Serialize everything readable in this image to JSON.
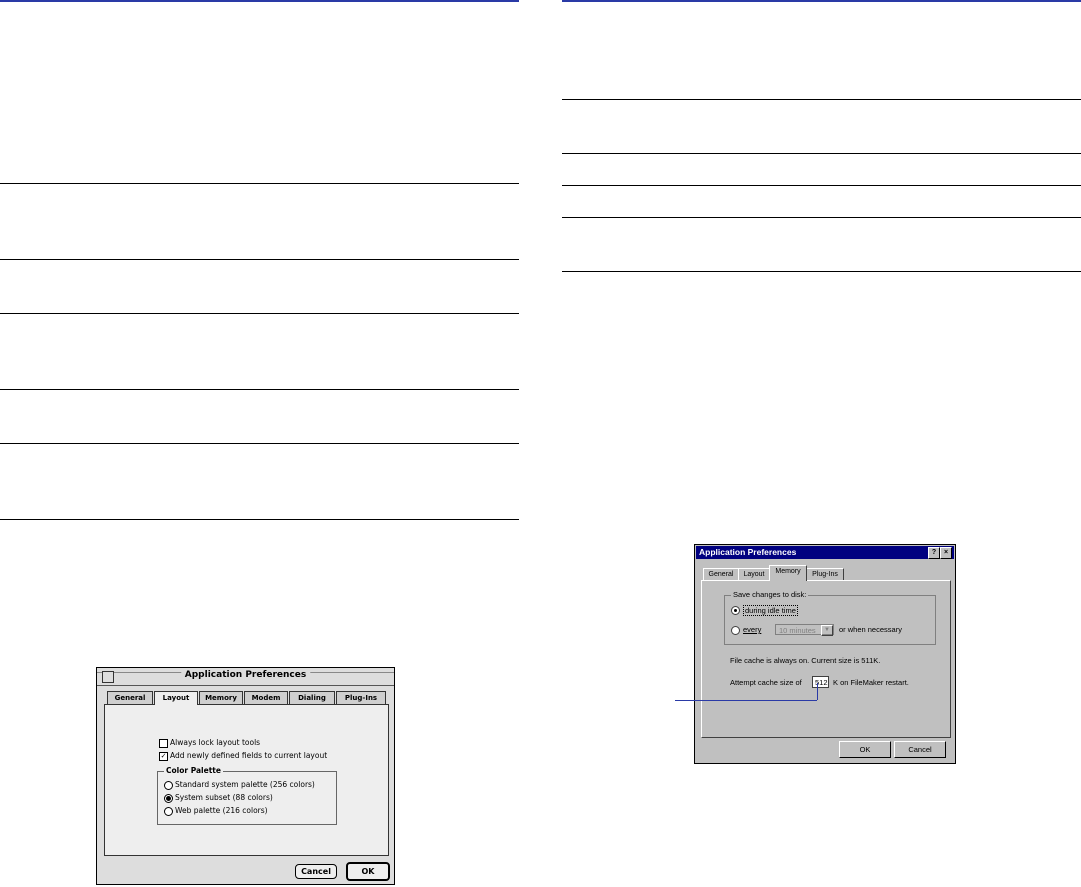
{
  "mac_dialog": {
    "title": "Application Preferences",
    "tabs": [
      "General",
      "Layout",
      "Memory",
      "Modem",
      "Dialing",
      "Plug-Ins"
    ],
    "active_tab": "Layout",
    "check_lock": "Always lock layout tools",
    "check_add": "Add newly defined fields to current layout",
    "palette_group": "Color Palette",
    "palette_options": [
      "Standard system palette (256 colors)",
      "System subset (88 colors)",
      "Web palette (216 colors)"
    ],
    "selected_palette": "System subset (88 colors)",
    "cancel": "Cancel",
    "ok": "OK"
  },
  "win_dialog": {
    "title": "Application Preferences",
    "help_btn": "?",
    "close_btn": "×",
    "tabs": [
      "General",
      "Layout",
      "Memory",
      "Plug-Ins"
    ],
    "active_tab": "Memory",
    "save_group": "Save changes to disk:",
    "opt_idle": "during idle time",
    "opt_every": "every",
    "interval": "10 minutes",
    "when_necessary": "or when necessary",
    "cache_info": "File cache is always on.  Current size is 511K.",
    "attempt_label": "Attempt cache size of",
    "cache_value": "512",
    "restart_label": "K on FileMaker restart.",
    "ok": "OK",
    "cancel": "Cancel"
  },
  "colors": {
    "accent": "#2a3aa6",
    "win_title": "#000080"
  }
}
